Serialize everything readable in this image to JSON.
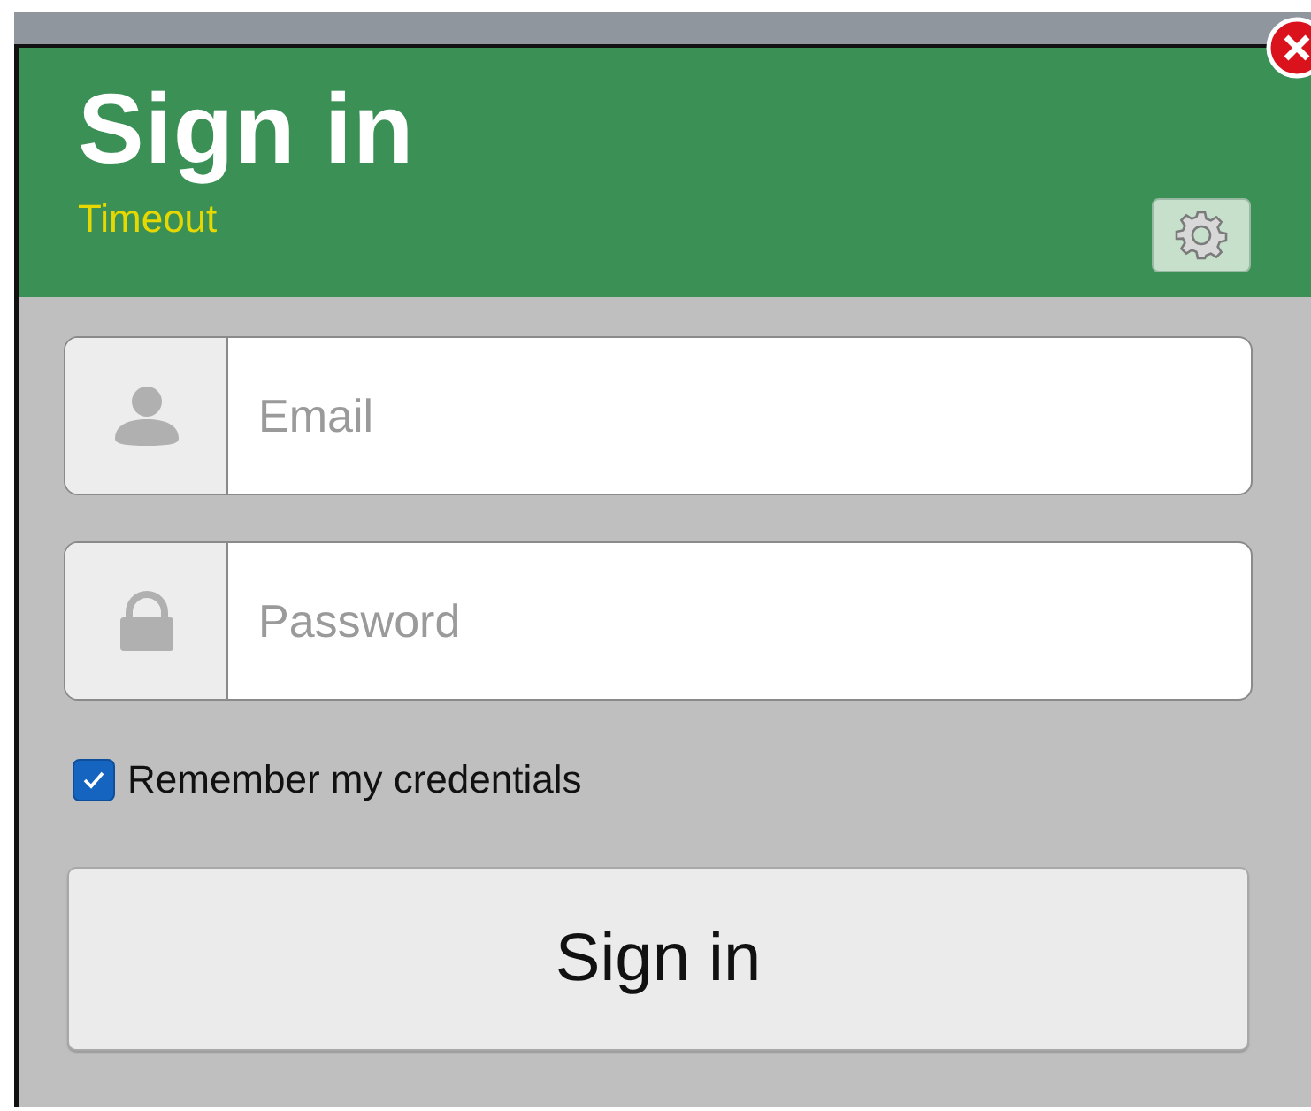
{
  "header": {
    "title": "Sign in",
    "subtitle": "Timeout"
  },
  "fields": [
    {
      "kind": "email",
      "placeholder": "Email"
    },
    {
      "kind": "password",
      "placeholder": "Password"
    }
  ],
  "remember": {
    "label": "Remember my credentials",
    "checked": true
  },
  "submit_button": "Sign in"
}
